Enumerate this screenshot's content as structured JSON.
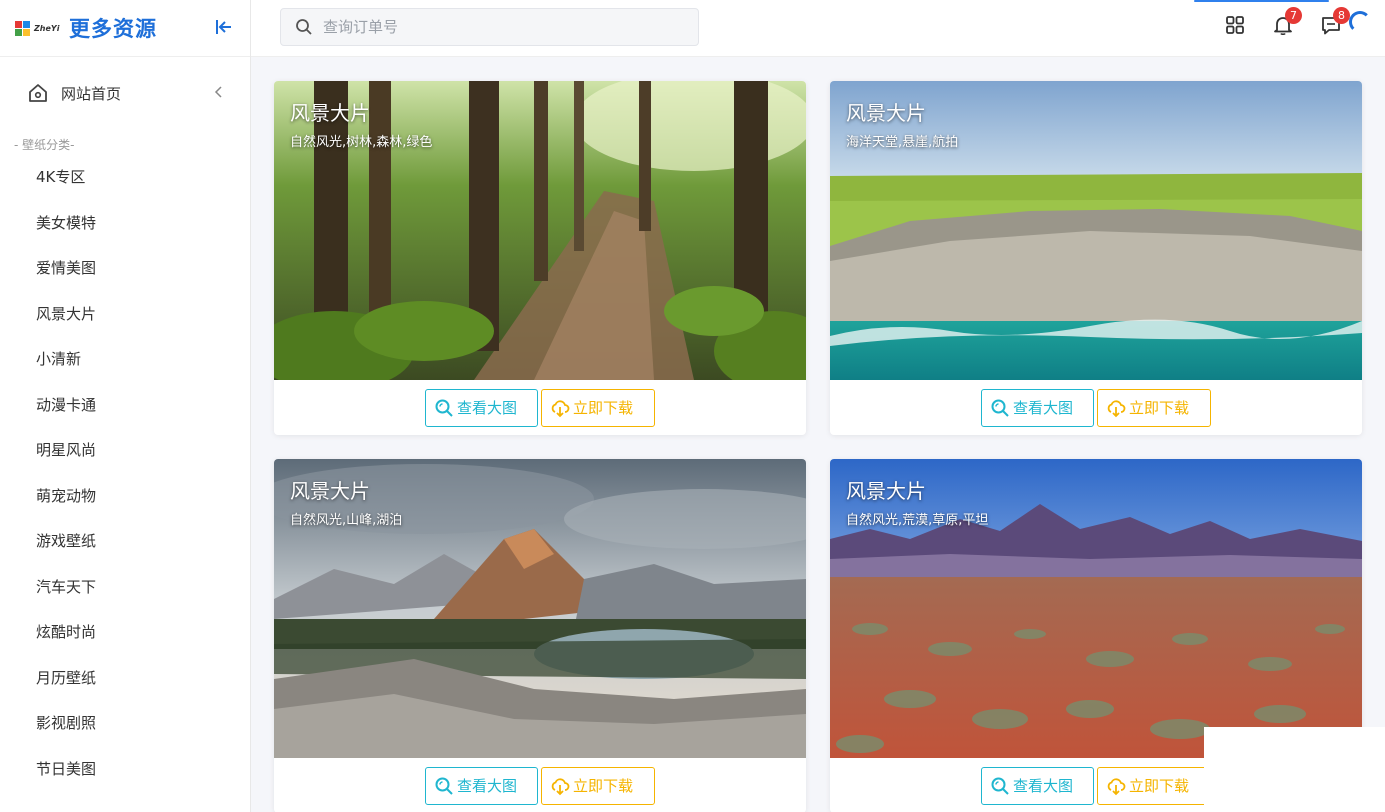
{
  "brand": {
    "logo_text": "ZheYi",
    "name": "更多资源"
  },
  "search": {
    "placeholder": "查询订单号"
  },
  "topbar": {
    "notifications_count": "7",
    "messages_count": "8"
  },
  "sidebar": {
    "home_label": "网站首页",
    "section_label": "- 壁纸分类-",
    "items": [
      {
        "label": "4K专区"
      },
      {
        "label": "美女模特"
      },
      {
        "label": "爱情美图"
      },
      {
        "label": "风景大片"
      },
      {
        "label": "小清新"
      },
      {
        "label": "动漫卡通"
      },
      {
        "label": "明星风尚"
      },
      {
        "label": "萌宠动物"
      },
      {
        "label": "游戏壁纸"
      },
      {
        "label": "汽车天下"
      },
      {
        "label": "炫酷时尚"
      },
      {
        "label": "月历壁纸"
      },
      {
        "label": "影视剧照"
      },
      {
        "label": "节日美图"
      }
    ]
  },
  "cards": [
    {
      "title": "风景大片",
      "tags": "自然风光,树林,森林,绿色",
      "view_label": "查看大图",
      "download_label": "立即下载"
    },
    {
      "title": "风景大片",
      "tags": "海洋天堂,悬崖,航拍",
      "view_label": "查看大图",
      "download_label": "立即下载"
    },
    {
      "title": "风景大片",
      "tags": "自然风光,山峰,湖泊",
      "view_label": "查看大图",
      "download_label": "立即下载"
    },
    {
      "title": "风景大片",
      "tags": "自然风光,荒漠,草原,平坦",
      "view_label": "查看大图",
      "download_label": "立即下载"
    }
  ],
  "colors": {
    "brand_blue": "#1e6fd9",
    "view_cyan": "#1fb6cf",
    "download_yellow": "#f5b400",
    "badge_red": "#e53935"
  }
}
